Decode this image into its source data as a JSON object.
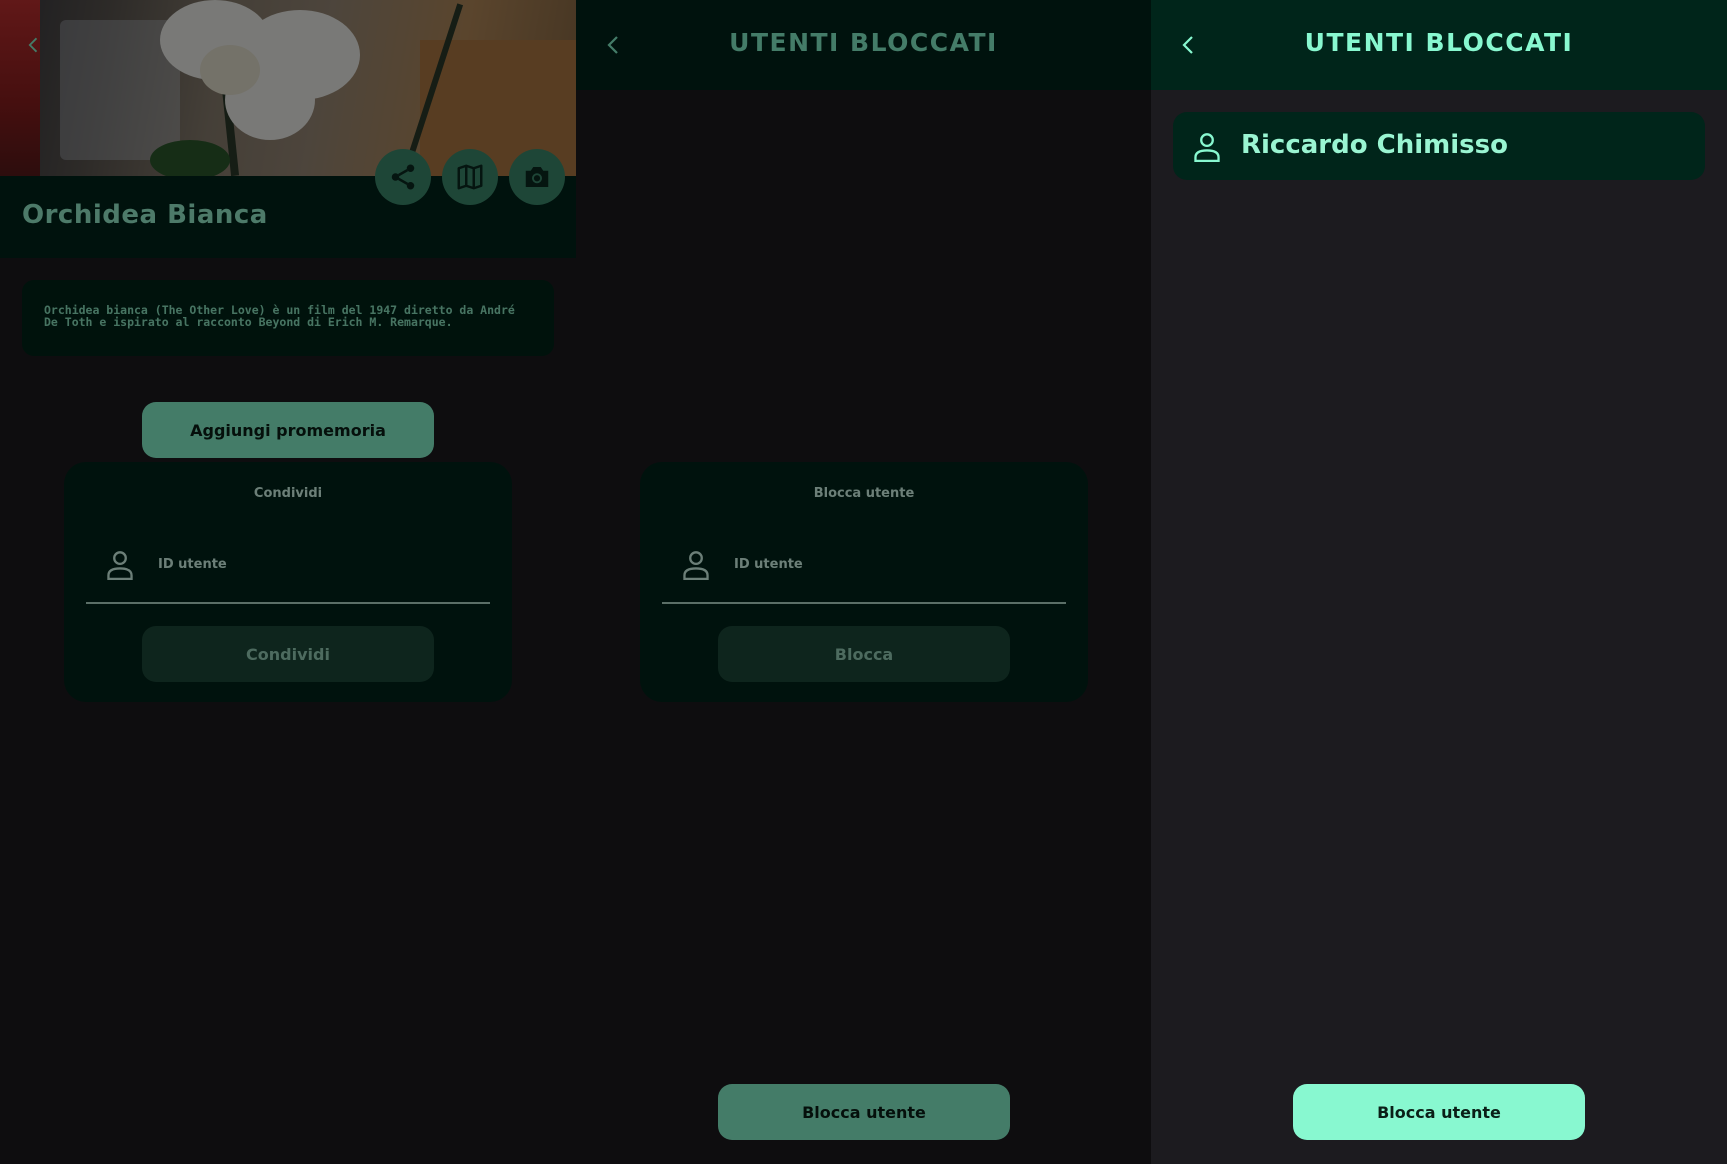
{
  "screen1": {
    "title": "Orchidea Bianca",
    "description": "Orchidea bianca (The Other Love) è un film del 1947 diretto da André De Toth e ispirato al racconto Beyond di Erich M. Remarque.",
    "reminder_label": "Aggiungi promemoria",
    "icons": [
      "chevron-left-icon",
      "share-icon",
      "map-icon",
      "camera-icon"
    ],
    "dialog": {
      "title": "Condividi",
      "field_placeholder": "ID utente",
      "confirm_label": "Condividi"
    }
  },
  "screen2": {
    "title": "UTENTI BLOCCATI",
    "dialog": {
      "title": "Blocca utente",
      "field_placeholder": "ID utente",
      "confirm_label": "Blocca"
    },
    "bottom_button": "Blocca utente"
  },
  "screen3": {
    "title": "UTENTI BLOCCATI",
    "blocked_users": [
      "Riccardo Chimisso"
    ],
    "bottom_button": "Blocca utente"
  },
  "colors": {
    "accent": "#88f8d0",
    "surface": "#00251a",
    "background": "#1c1b1f",
    "button_dim": "#4a9a7d"
  }
}
